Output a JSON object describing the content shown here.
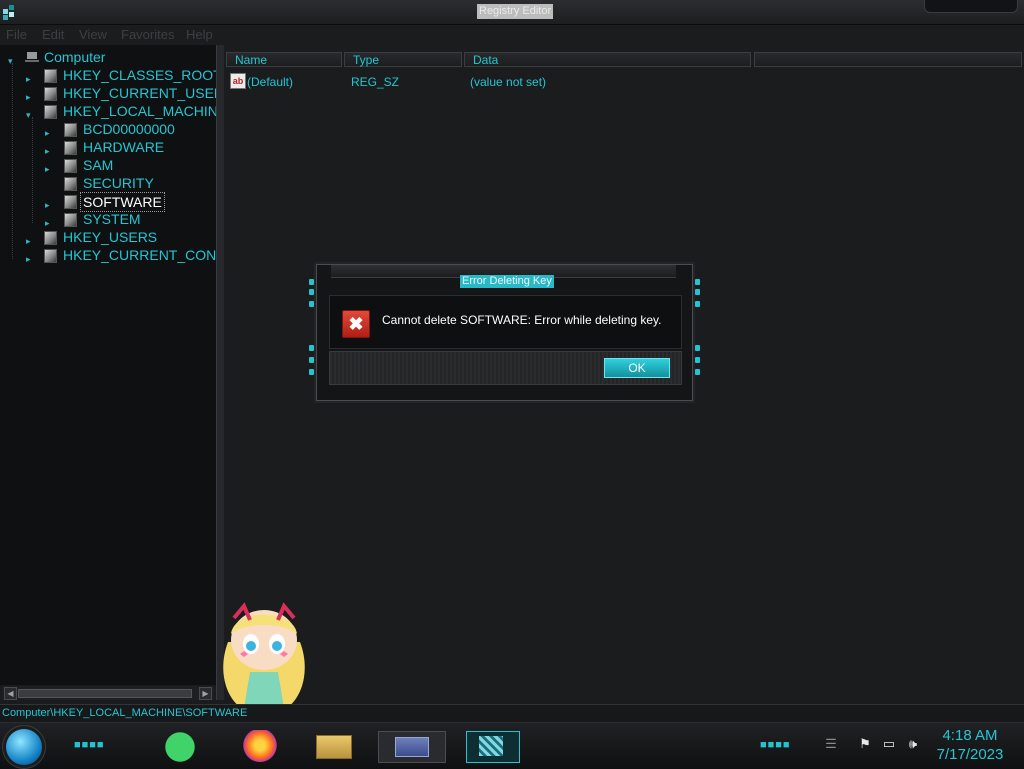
{
  "window": {
    "title": "Registry Editor"
  },
  "menu": {
    "items": [
      "File",
      "Edit",
      "View",
      "Favorites",
      "Help"
    ]
  },
  "tree": {
    "nodes": [
      {
        "label": "Computer"
      },
      {
        "label": "HKEY_CLASSES_ROOT"
      },
      {
        "label": "HKEY_CURRENT_USER"
      },
      {
        "label": "HKEY_LOCAL_MACHINE"
      },
      {
        "label": "BCD00000000"
      },
      {
        "label": "HARDWARE"
      },
      {
        "label": "SAM"
      },
      {
        "label": "SECURITY"
      },
      {
        "label": "SOFTWARE"
      },
      {
        "label": "SYSTEM"
      },
      {
        "label": "HKEY_USERS"
      },
      {
        "label": "HKEY_CURRENT_CONFI"
      }
    ]
  },
  "list": {
    "columns": [
      "Name",
      "Type",
      "Data"
    ],
    "rows": [
      {
        "name": "(Default)",
        "type": "REG_SZ",
        "data": "(value not set)"
      }
    ]
  },
  "status": {
    "path": "Computer\\HKEY_LOCAL_MACHINE\\SOFTWARE"
  },
  "dialog": {
    "title": "Error Deleting Key",
    "message": "Cannot delete SOFTWARE:  Error while deleting key.",
    "ok_label": "OK"
  },
  "taskbar": {
    "apps": [
      "spotify-icon",
      "firefox-icon",
      "file-explorer-icon",
      "registry-editor-icon",
      "registry-editor-icon"
    ],
    "tray": [
      "flag-icon",
      "network-icon",
      "volume-icon"
    ],
    "time": "4:18 AM",
    "date": "7/17/2023"
  },
  "colors": {
    "accent": "#23c6d3",
    "background": "#1b1c1e",
    "tree_background": "#0f1011",
    "error_red": "#c8281e"
  }
}
